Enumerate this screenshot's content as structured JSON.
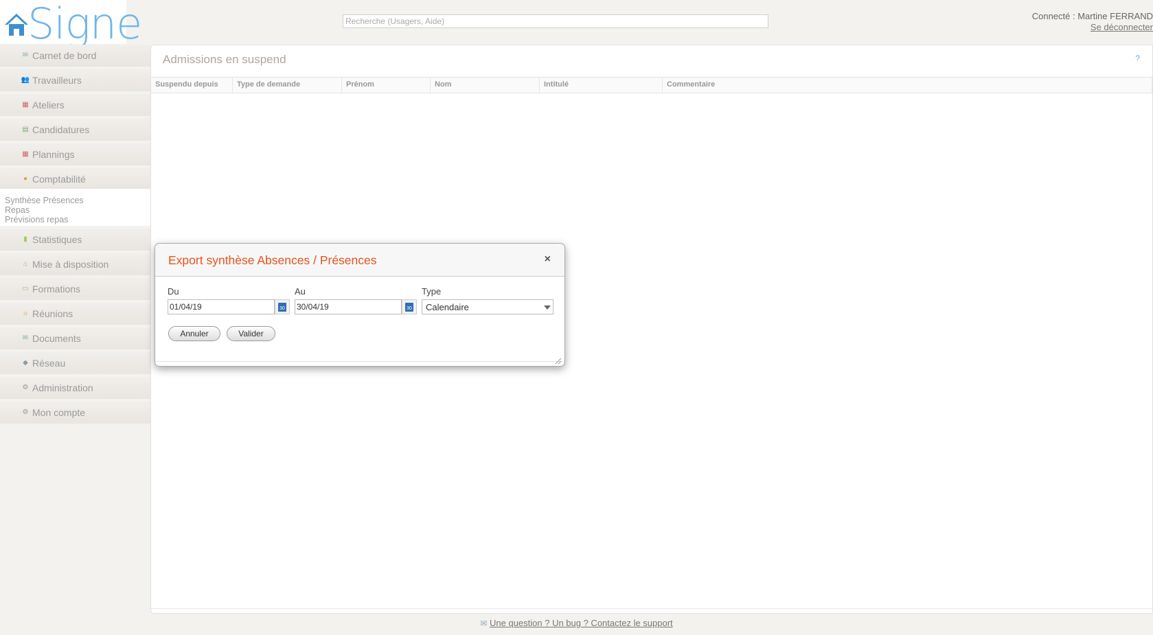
{
  "header": {
    "logo_text": "Signe",
    "search_placeholder": "Recherche (Usagers, Aide)",
    "connected_label": "Connecté : Martine FERRAND",
    "logout": "Se déconnecter"
  },
  "sidebar": {
    "items_top": [
      {
        "label": "Carnet de bord",
        "icon": "envelope-icon"
      },
      {
        "label": "Travailleurs",
        "icon": "users-icon"
      },
      {
        "label": "Ateliers",
        "icon": "calendar-icon"
      },
      {
        "label": "Candidatures",
        "icon": "folder-icon"
      },
      {
        "label": "Plannings",
        "icon": "calendar-icon"
      },
      {
        "label": "Comptabilité",
        "icon": "coins-icon"
      }
    ],
    "submenu": [
      "Synthèse Présences",
      "Repas",
      "Prévisions repas"
    ],
    "items_bottom": [
      {
        "label": "Statistiques",
        "icon": "chart-icon"
      },
      {
        "label": "Mise à disposition",
        "icon": "house-icon"
      },
      {
        "label": "Formations",
        "icon": "board-icon"
      },
      {
        "label": "Réunions",
        "icon": "meeting-icon"
      },
      {
        "label": "Documents",
        "icon": "envelope-icon"
      },
      {
        "label": "Réseau",
        "icon": "network-icon"
      },
      {
        "label": "Administration",
        "icon": "settings-icon"
      },
      {
        "label": "Mon compte",
        "icon": "settings-icon"
      }
    ]
  },
  "main": {
    "title": "Admissions en suspend",
    "help": "?",
    "columns": [
      "Suspendu depuis",
      "Type de demande",
      "Prénom",
      "Nom",
      "Intitulé",
      "Commentaire"
    ]
  },
  "dialog": {
    "title": "Export synthèse Absences / Présences",
    "close": "×",
    "du_label": "Du",
    "du_value": "01/04/19",
    "au_label": "Au",
    "au_value": "30/04/19",
    "type_label": "Type",
    "type_value": "Calendaire",
    "cancel": "Annuler",
    "submit": "Valider"
  },
  "footer": {
    "support": "Une question ? Un bug ? Contactez le support"
  },
  "colors": {
    "accent": "#e8531b",
    "logo": "#6fb6e8"
  }
}
